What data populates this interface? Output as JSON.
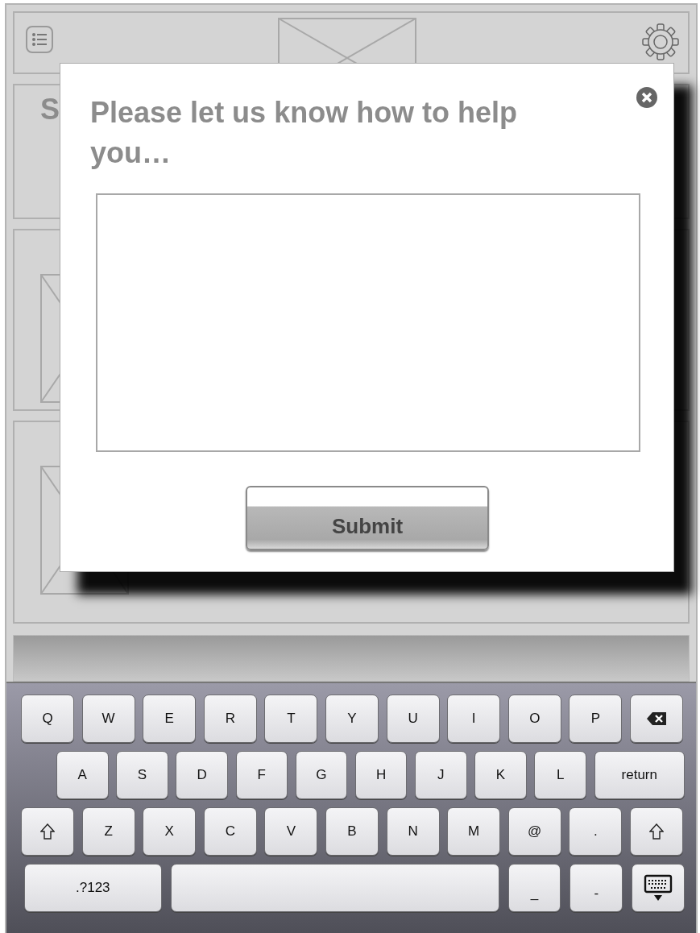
{
  "cards": [
    {
      "kind": "text",
      "heading": "S"
    },
    {
      "kind": "picture"
    },
    {
      "kind": "picture"
    }
  ],
  "dialog": {
    "title": "Please let us know how to help you…",
    "submit": "Submit"
  },
  "keyboard": {
    "top_row": [
      {
        "kind": "char",
        "label": "Q"
      },
      {
        "kind": "char",
        "label": "W"
      },
      {
        "kind": "char",
        "label": "E"
      },
      {
        "kind": "char",
        "label": "R"
      },
      {
        "kind": "char",
        "label": "T"
      },
      {
        "kind": "char",
        "label": "Y"
      },
      {
        "kind": "char",
        "label": "U"
      },
      {
        "kind": "char",
        "label": "I"
      },
      {
        "kind": "char",
        "label": "O"
      },
      {
        "kind": "char",
        "label": "P"
      },
      {
        "kind": "backspace"
      }
    ],
    "home_row": [
      {
        "kind": "char",
        "label": "A"
      },
      {
        "kind": "char",
        "label": "S"
      },
      {
        "kind": "char",
        "label": "D"
      },
      {
        "kind": "char",
        "label": "F"
      },
      {
        "kind": "char",
        "label": "G"
      },
      {
        "kind": "char",
        "label": "H"
      },
      {
        "kind": "char",
        "label": "J"
      },
      {
        "kind": "char",
        "label": "K"
      },
      {
        "kind": "char",
        "label": "L"
      },
      {
        "kind": "wide",
        "label": "return"
      }
    ],
    "bottom_row": [
      {
        "kind": "shift"
      },
      {
        "kind": "char",
        "label": "Z"
      },
      {
        "kind": "char",
        "label": "X"
      },
      {
        "kind": "char",
        "label": "C"
      },
      {
        "kind": "char",
        "label": "V"
      },
      {
        "kind": "char",
        "label": "B"
      },
      {
        "kind": "char",
        "label": "N"
      },
      {
        "kind": "char",
        "label": "M"
      },
      {
        "kind": "char",
        "label": "@"
      },
      {
        "kind": "char",
        "label": "."
      },
      {
        "kind": "shift"
      }
    ],
    "space_row": [
      {
        "kind": "mode",
        "label": ".?123"
      },
      {
        "kind": "space"
      },
      {
        "kind": "char",
        "label": "_"
      },
      {
        "kind": "char",
        "label": "-"
      },
      {
        "kind": "hide"
      }
    ]
  }
}
